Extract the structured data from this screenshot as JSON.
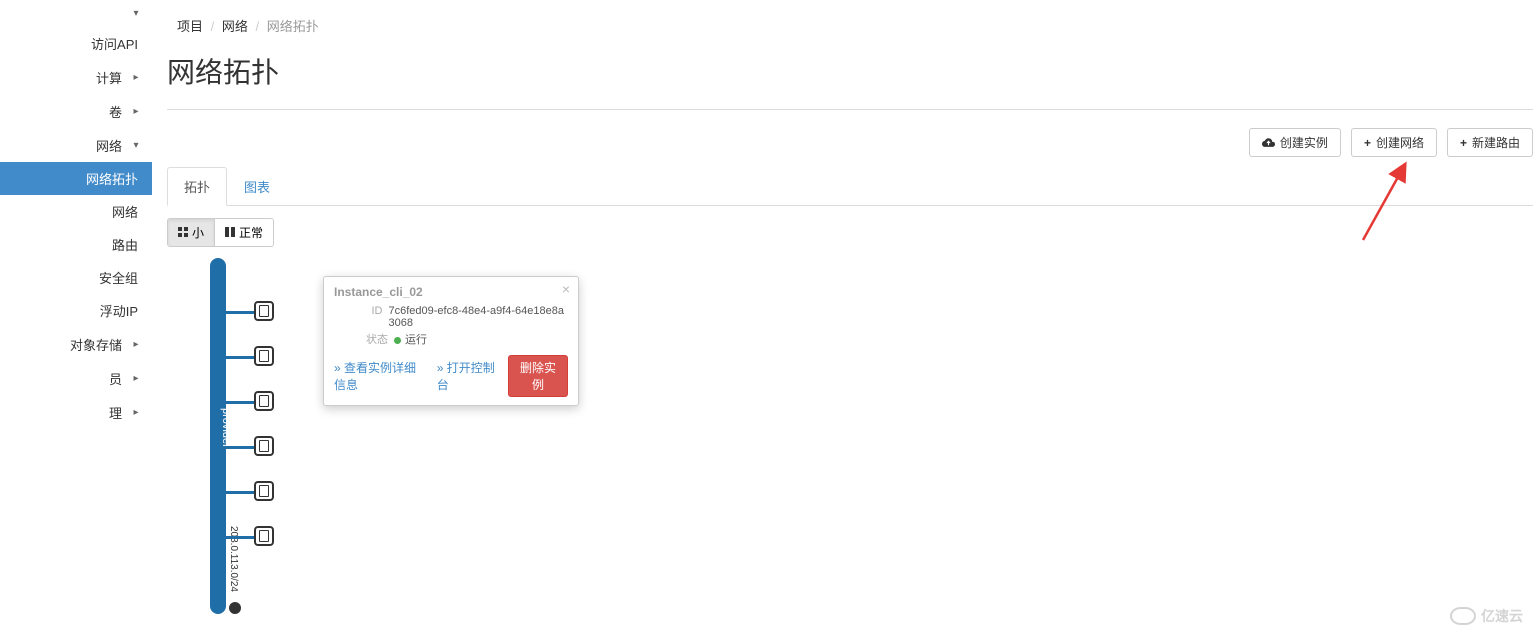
{
  "sidebar": {
    "top_chevron_only": true,
    "api_link": "访问API",
    "items": [
      {
        "label": "计算",
        "chev": "right"
      },
      {
        "label": "卷",
        "chev": "right"
      },
      {
        "label": "网络",
        "chev": "down"
      }
    ],
    "network_sub": [
      {
        "label": "网络拓扑",
        "active": true
      },
      {
        "label": "网络"
      },
      {
        "label": "路由"
      },
      {
        "label": "安全组"
      },
      {
        "label": "浮动IP"
      }
    ],
    "more": [
      {
        "label": "对象存储",
        "chev": "right"
      },
      {
        "label": "员",
        "chev": "right",
        "truncated": true
      },
      {
        "label": "理",
        "chev": "right",
        "truncated": true
      }
    ]
  },
  "breadcrumb": {
    "items": [
      "项目",
      "网络",
      "网络拓扑"
    ]
  },
  "page_title": "网络拓扑",
  "actions": {
    "create_instance": "创建实例",
    "create_network": "创建网络",
    "create_router": "新建路由"
  },
  "tabs": {
    "topology": "拓扑",
    "chart": "图表"
  },
  "view_toggle": {
    "small": "小",
    "normal": "正常"
  },
  "network": {
    "name": "provider",
    "cidr": "203.0.113.0/24",
    "instances_count": 6
  },
  "popup": {
    "title": "Instance_cli_02",
    "id_label": "ID",
    "id_value": "7c6fed09-efc8-48e4-a9f4-64e18e8a3068",
    "status_label": "状态",
    "status_value": "运行",
    "view_details": "» 查看实例详细信息",
    "open_console": "» 打开控制台",
    "delete_instance": "删除实例",
    "close": "×"
  },
  "watermark": "亿速云"
}
